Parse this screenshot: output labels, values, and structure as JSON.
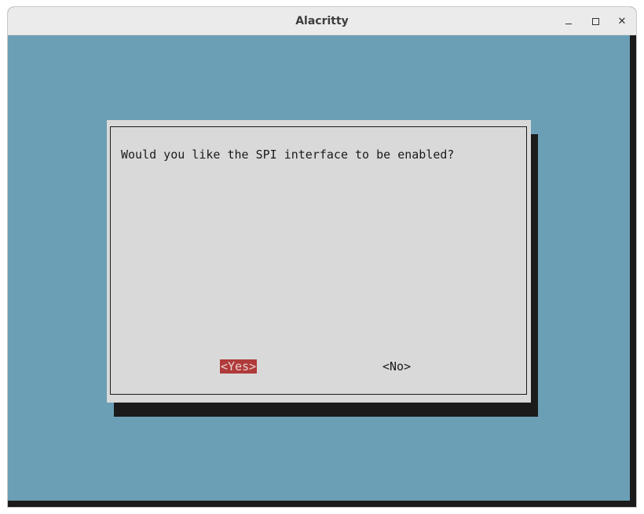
{
  "window": {
    "title": "Alacritty",
    "controls": {
      "minimize_icon": "minimize-icon",
      "maximize_icon": "maximize-icon",
      "close_icon": "close-icon",
      "close_glyph": "✕"
    }
  },
  "dialog": {
    "question": "Would you like the SPI interface to be enabled?",
    "buttons": {
      "yes": "<Yes>",
      "no": "<No>"
    },
    "selected": "yes"
  },
  "colors": {
    "terminal_background": "#6b9fb5",
    "dialog_background": "#d9d9d9",
    "shadow": "#1b1b1b",
    "selected_button": "#b03a3a"
  }
}
